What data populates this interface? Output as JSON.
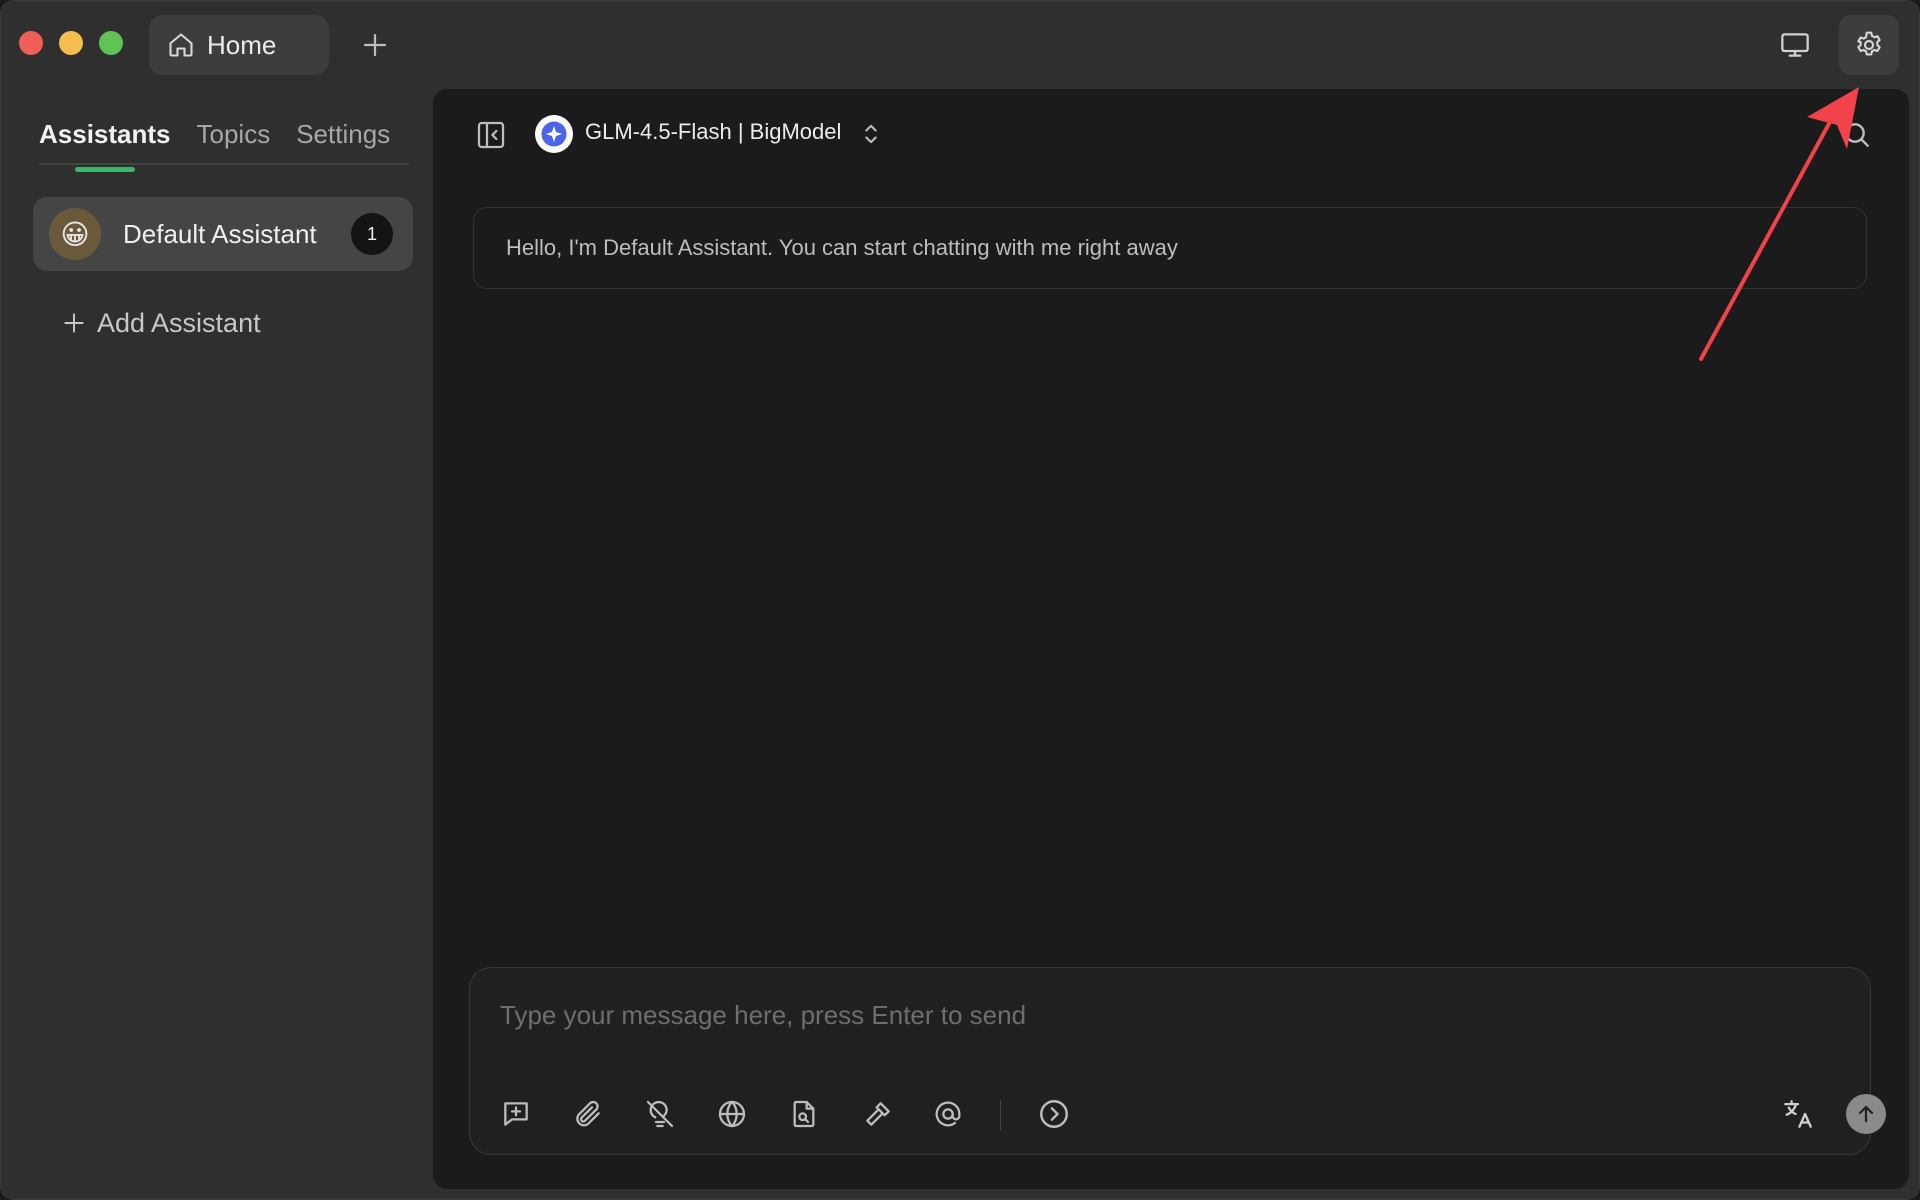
{
  "window": {
    "tab_label": "Home"
  },
  "sidebar": {
    "tabs": [
      {
        "label": "Assistants",
        "active": true
      },
      {
        "label": "Topics",
        "active": false
      },
      {
        "label": "Settings",
        "active": false
      }
    ],
    "assistant": {
      "name": "Default Assistant",
      "avatar_emoji": "😀",
      "count": "1"
    },
    "add_assistant_label": "Add Assistant"
  },
  "main": {
    "model_name": "GLM-4.5-Flash | BigModel",
    "welcome_text": "Hello, I'm Default Assistant. You can start chatting with me right away",
    "composer": {
      "placeholder": "Type your message here, press Enter to send",
      "value": ""
    }
  },
  "icons": {
    "home": "home-icon",
    "add_tab": "plus-icon",
    "display": "monitor-icon",
    "settings": "gear-icon",
    "collapse": "sidebar-collapse-icon",
    "model_chevron": "chevron-up-down-icon",
    "search": "search-icon",
    "tools": [
      "new-topic-icon",
      "paperclip-icon",
      "lightbulb-off-icon",
      "globe-icon",
      "knowledge-file-icon",
      "hammer-icon",
      "at-icon",
      "circle-arrow-right-icon"
    ],
    "translate": "translate-icon",
    "send": "arrow-up-icon"
  },
  "colors": {
    "accent": "#3fb26a",
    "annotation_arrow": "#f2434a",
    "traffic_close": "#ee5f57",
    "traffic_min": "#f5bd4f",
    "traffic_max": "#5fc454"
  }
}
